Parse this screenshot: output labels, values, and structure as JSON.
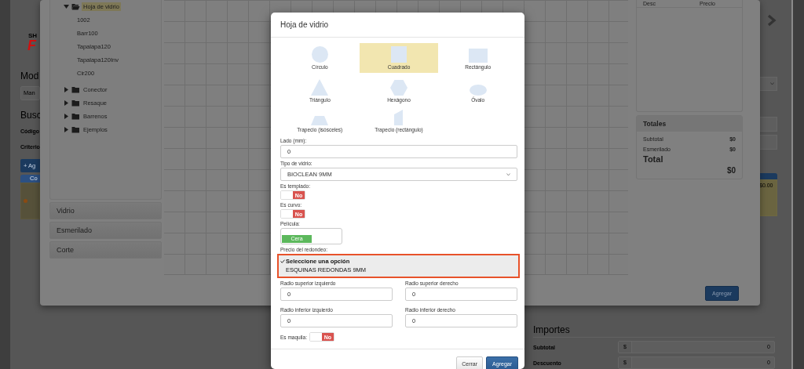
{
  "background_page": {
    "logo_text": "SH",
    "logo_mark": "F",
    "heading_model": "Mod",
    "model_select_value": "Man",
    "heading_search": "Busc",
    "code_label": "Código",
    "criteria_label": "Criterio",
    "add_button": "+ Ag",
    "tab_label": "Co",
    "card_price": "$0.00",
    "amounts": {
      "title": "Importes",
      "rows": [
        {
          "label": "Subtotal",
          "prefix": "$",
          "value": "0"
        },
        {
          "label": "Descuento",
          "prefix": "$",
          "value": "0"
        }
      ]
    }
  },
  "designer_dialog": {
    "tree": [
      {
        "label": "Hoja de vidrio",
        "expanded": true,
        "selected": true,
        "children": [
          {
            "label": "1002",
            "selected": false
          },
          {
            "label": "Barr100",
            "selected": false
          },
          {
            "label": "Tapalapa120",
            "selected": false
          },
          {
            "label": "Tapalapa120Inv",
            "selected": false
          },
          {
            "label": "Cir200",
            "selected": false
          }
        ]
      },
      {
        "label": "Conector",
        "expanded": false,
        "selected": false
      },
      {
        "label": "Resaque",
        "expanded": false,
        "selected": false
      },
      {
        "label": "Barrenos",
        "expanded": false,
        "selected": false
      },
      {
        "label": "Ejemplos",
        "expanded": false,
        "selected": false
      }
    ],
    "sections": [
      "Vidrio",
      "Esmerilado",
      "Corte"
    ],
    "items_table": {
      "columns": [
        "Desc",
        "Precio"
      ]
    },
    "totals": {
      "title": "Totales",
      "rows": [
        {
          "label": "Subtotal",
          "value": "$0"
        },
        {
          "label": "Esmerilado",
          "value": "$0"
        }
      ],
      "total_label": "Total",
      "total_value": "$0"
    },
    "add_button": "Agregar"
  },
  "modal": {
    "title": "Hoja de vidrio",
    "shapes": [
      {
        "kind": "circle",
        "label": "Círculo",
        "selected": false
      },
      {
        "kind": "square",
        "label": "Cuadrado",
        "selected": true
      },
      {
        "kind": "rectangle",
        "label": "Rectángulo",
        "selected": false
      },
      {
        "kind": "triangle",
        "label": "Triángulo",
        "selected": false
      },
      {
        "kind": "hexagon",
        "label": "Hexágono",
        "selected": false
      },
      {
        "kind": "oval",
        "label": "Óvalo",
        "selected": false
      },
      {
        "kind": "isosceles_trapezoid",
        "label": "Trapecio (isósceles)",
        "selected": false
      },
      {
        "kind": "right_trapezoid",
        "label": "Trapecio (rectángulo)",
        "selected": false
      }
    ],
    "side": {
      "label": "Lado (mm):",
      "value": "0"
    },
    "glass_type": {
      "label": "Tipo de vidrio:",
      "value": "BIOCLEAN 9MM"
    },
    "tempered": {
      "label": "Es templado:",
      "on": false,
      "state_label": "No"
    },
    "curved": {
      "label": "Es curvo:",
      "on": false,
      "state_label": "No"
    },
    "film": {
      "label": "Película:",
      "options": [
        {
          "label": "Cera",
          "selected": true
        }
      ]
    },
    "rounding_price": {
      "label": "Precio del redondeo:",
      "options": [
        {
          "label": "Seleccione una opción",
          "selected": true
        },
        {
          "label": "ESQUINAS REDONDAS 9MM",
          "selected": false
        }
      ]
    },
    "radii": [
      {
        "label": "Radio superior izquierdo",
        "value": "0"
      },
      {
        "label": "Radio superior derecho",
        "value": "0"
      },
      {
        "label": "Radio inferior izquierdo",
        "value": "0"
      },
      {
        "label": "Radio inferior derecho",
        "value": "0"
      }
    ],
    "maquila": {
      "label": "Es maquila:",
      "on": false,
      "state_label": "No"
    },
    "buttons": [
      {
        "label": "Cerrar",
        "kind": "default"
      },
      {
        "label": "Agregar",
        "kind": "primary"
      }
    ]
  }
}
